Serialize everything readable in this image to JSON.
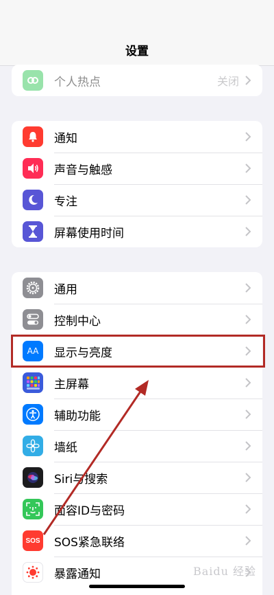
{
  "header": {
    "title": "设置"
  },
  "group_top": {
    "items": [
      {
        "label": "个人热点",
        "value": "关闭",
        "icon": "hotspot-icon",
        "color": "#34c759"
      }
    ]
  },
  "group_notifications": {
    "items": [
      {
        "label": "通知",
        "icon": "bell-icon",
        "color": "#ff3b30"
      },
      {
        "label": "声音与触感",
        "icon": "speaker-icon",
        "color": "#ff2d55"
      },
      {
        "label": "专注",
        "icon": "moon-icon",
        "color": "#5856d6"
      },
      {
        "label": "屏幕使用时间",
        "icon": "hourglass-icon",
        "color": "#5856d6"
      }
    ]
  },
  "group_general": {
    "items": [
      {
        "label": "通用",
        "icon": "gear-icon",
        "color": "#8e8e93"
      },
      {
        "label": "控制中心",
        "icon": "toggles-icon",
        "color": "#8e8e93"
      },
      {
        "label": "显示与亮度",
        "icon": "aa-icon",
        "color": "#007aff"
      },
      {
        "label": "主屏幕",
        "icon": "grid-icon",
        "color": "#3b5bdb"
      },
      {
        "label": "辅助功能",
        "icon": "accessibility-icon",
        "color": "#007aff"
      },
      {
        "label": "墙纸",
        "icon": "flower-icon",
        "color": "#32ade6"
      },
      {
        "label": "Siri与搜索",
        "icon": "siri-icon",
        "color": "#1c1c1e"
      },
      {
        "label": "面容ID与密码",
        "icon": "faceid-icon",
        "color": "#34c759"
      },
      {
        "label": "SOS紧急联络",
        "icon": "sos-icon",
        "color": "#ff3b30"
      },
      {
        "label": "暴露通知",
        "icon": "exposure-icon",
        "color": "#ffffff"
      }
    ]
  },
  "icon_text": {
    "aa": "AA",
    "sos": "SOS"
  },
  "watermark": "Baidu 经验",
  "colors": {
    "highlight": "#b22a25",
    "arrow": "#b22a25",
    "background": "#f2f2f7"
  }
}
